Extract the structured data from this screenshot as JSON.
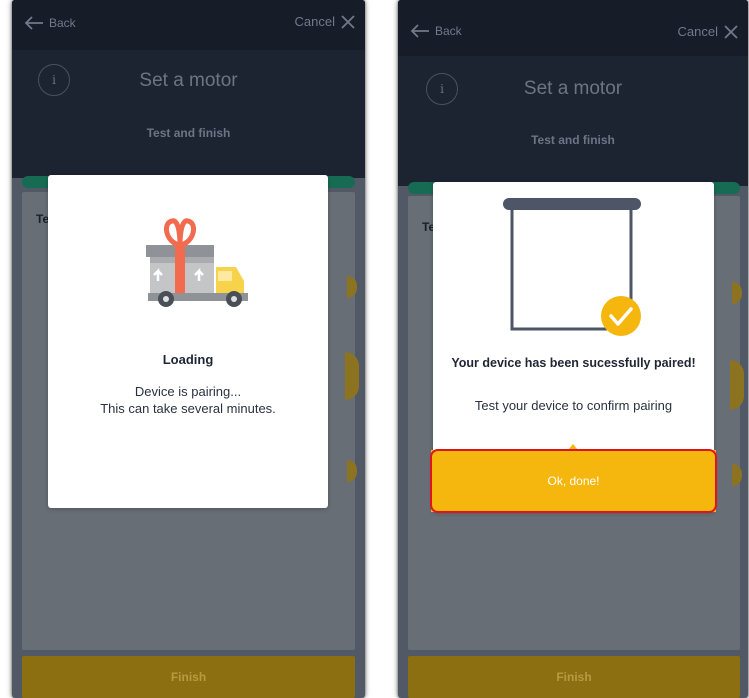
{
  "nav": {
    "back_label": "Back",
    "cancel_label": "Cancel"
  },
  "header": {
    "info_label": "i",
    "title": "Set a motor",
    "subtitle": "Test and finish"
  },
  "card": {
    "partial_text": "Te co"
  },
  "footer": {
    "finish_label": "Finish"
  },
  "loading_modal": {
    "title": "Loading",
    "line1": "Device is pairing...",
    "line2": "This can take several minutes.",
    "icon": "delivery-truck-gift-icon"
  },
  "paired_modal": {
    "title": "Your device has been sucessfully paired!",
    "body": "Test your device to confirm pairing",
    "button_label": "Ok, done!",
    "icon": "roller-shade-check-icon"
  },
  "colors": {
    "accent_yellow": "#f5b60d",
    "progress_green": "#176b52",
    "header_dark": "#1c2331",
    "highlight_red": "#e0141e"
  }
}
